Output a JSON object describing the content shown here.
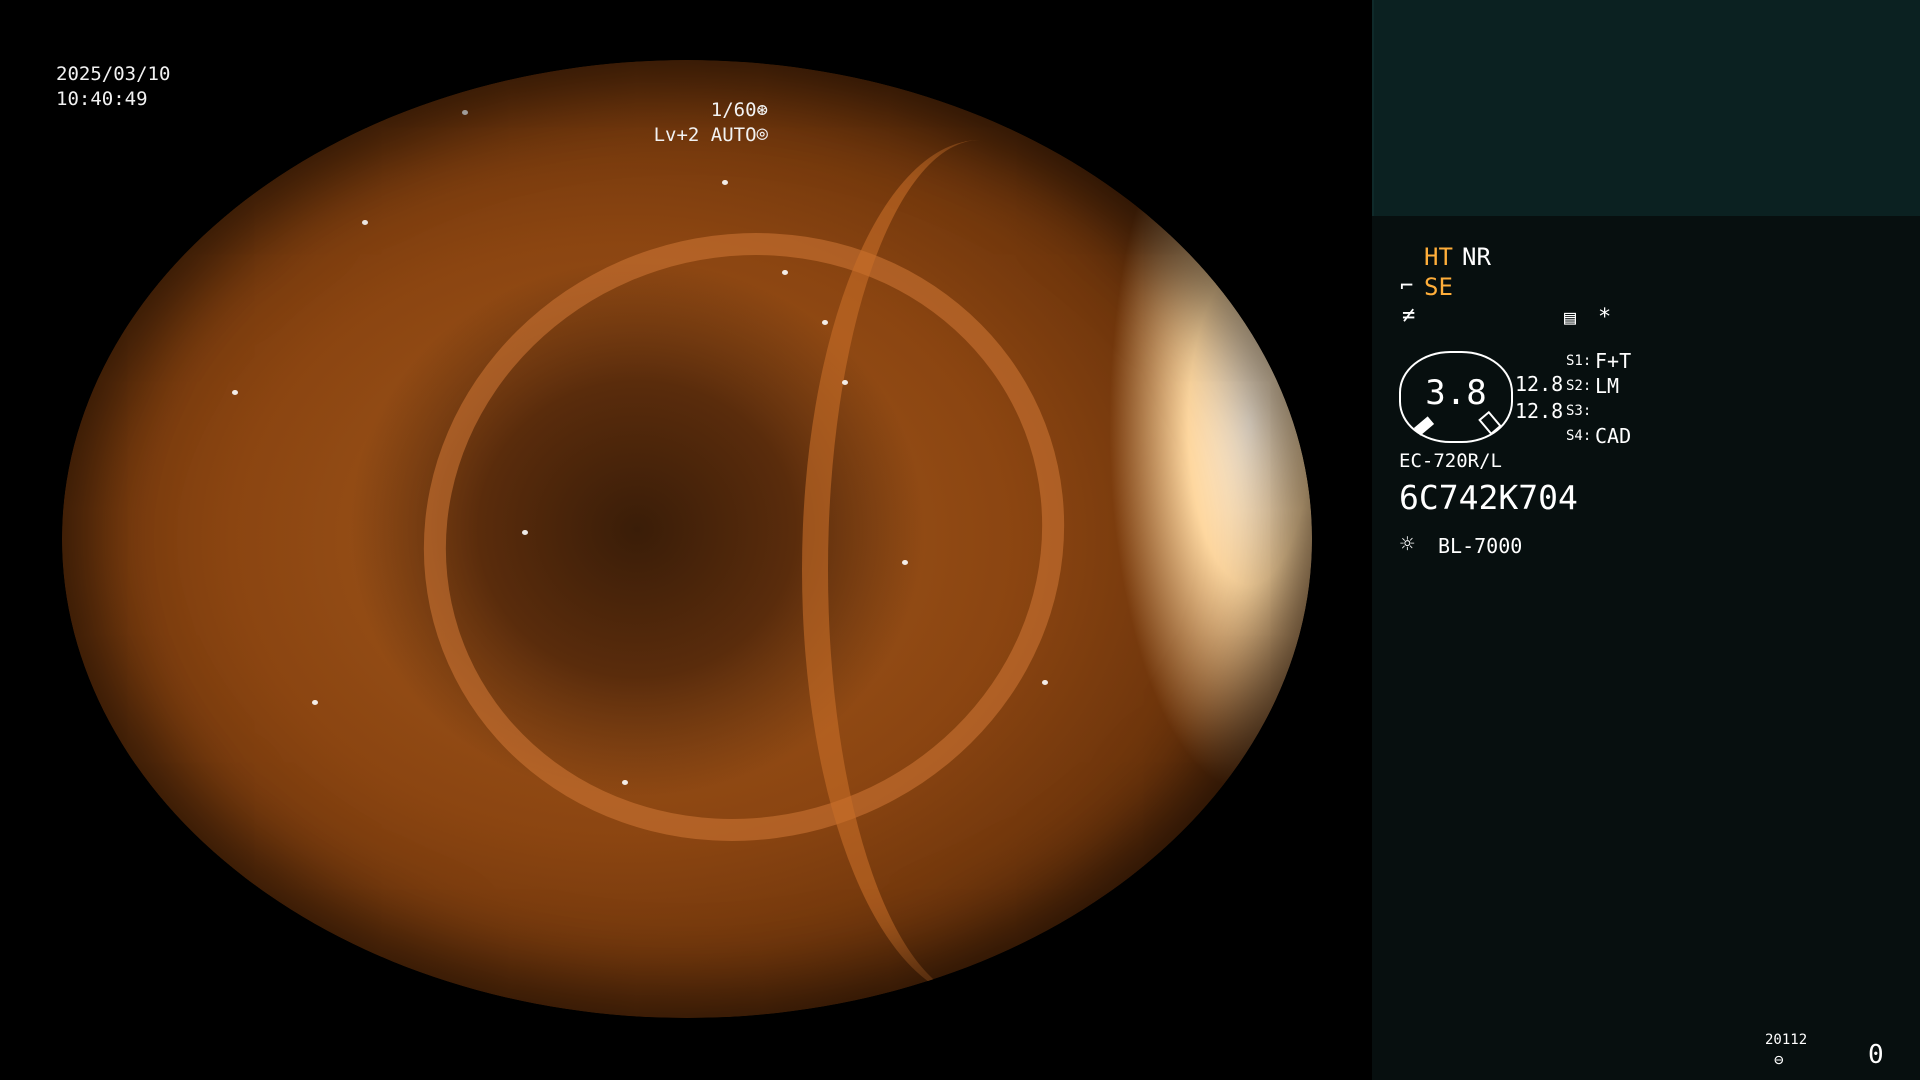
{
  "osd": {
    "date": "2025/03/10",
    "time": "10:40:49",
    "shutter": "1/60",
    "level": "Lv+2 AUTO"
  },
  "panel": {
    "ht": "HT",
    "nr": "NR",
    "se": "SE",
    "zoom": "3.8",
    "val1": "12.8",
    "val2": "12.8",
    "s1": "S1:",
    "s1v": "F+T",
    "s2": "S2:",
    "s2v": "LM",
    "s3": "S3:",
    "s3v": "",
    "s4": "S4:",
    "s4v": "CAD",
    "scope_model": "EC-720R/L",
    "serial": "6C742K704",
    "light_source": "BL-7000",
    "storage_code": "20112",
    "count": "0"
  }
}
